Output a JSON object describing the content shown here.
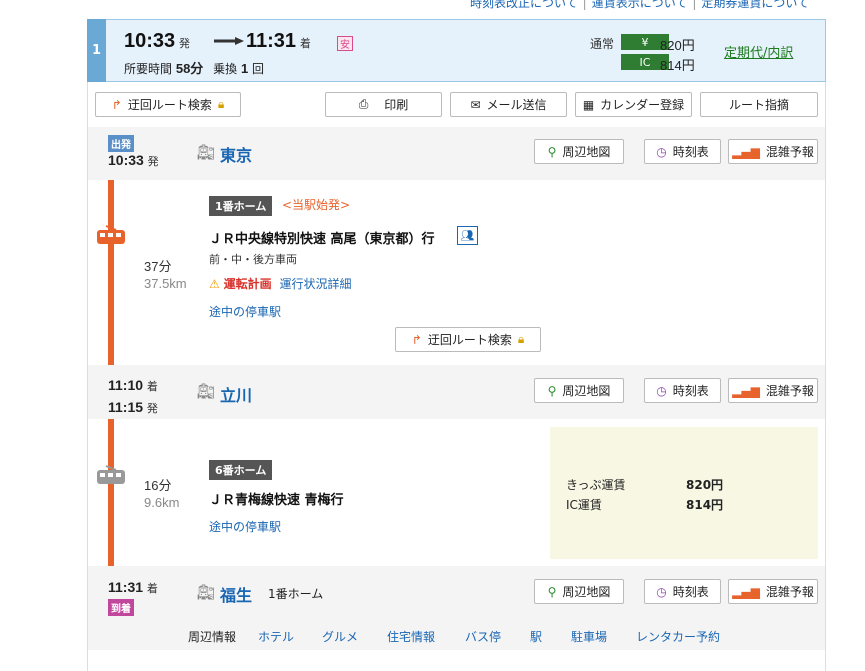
{
  "top_links": [
    "時刻表改正について",
    "運賃表示について",
    "定期券運賃について"
  ],
  "summary": {
    "route_number": "1",
    "depart_time": "10:33",
    "depart_suffix": "発",
    "arrive_time": "11:31",
    "arrive_suffix": "着",
    "safe_badge": "安",
    "duration_label": "所要時間",
    "duration_value": "58分",
    "transfer_label": "乗換",
    "transfer_value": "1",
    "transfer_unit": "回",
    "fare_normal_label": "通常",
    "fare_normal_badge": "¥",
    "fare_normal_amount": "820円",
    "fare_ic_badge": "IC",
    "fare_ic_amount": "814円",
    "teiki_link": "定期代/内訳"
  },
  "toolbar": {
    "detour_search": "迂回ルート検索",
    "print": "印刷",
    "mail": "メール送信",
    "calendar": "カレンダー登録",
    "route_guide": "ルート指摘"
  },
  "station_buttons": {
    "map": "周辺地図",
    "timetable": "時刻表",
    "congestion": "混雑予報"
  },
  "stations": {
    "tokyo": {
      "badge": "出発",
      "time": "10:33",
      "suffix": "発",
      "name": "東京"
    },
    "tachikawa": {
      "arrive_time": "11:10",
      "arrive_suffix": "着",
      "depart_time": "11:15",
      "depart_suffix": "発",
      "name": "立川"
    },
    "fussa": {
      "time": "11:31",
      "suffix": "着",
      "badge": "到着",
      "name": "福生",
      "platform": "1番ホーム"
    }
  },
  "segments": {
    "seg1": {
      "platform": "1番ホーム",
      "origin_note": "<当駅始発>",
      "train": "ＪＲ中央線特別快速 高尾（東京都）行",
      "cars": "前・中・後方車両",
      "warning": "運転計画",
      "status_link": "運行状況詳細",
      "stops_link": "途中の停車駅",
      "duration": "37分",
      "distance": "37.5km",
      "detour": "迂回ルート検索"
    },
    "seg2": {
      "platform": "6番ホーム",
      "train": "ＪＲ青梅線快速 青梅行",
      "stops_link": "途中の停車駅",
      "duration": "16分",
      "distance": "9.6km"
    }
  },
  "fare_box": {
    "ticket_label": "きっぷ運賃",
    "ticket_amount": "820円",
    "ic_label": "IC運賃",
    "ic_amount": "814円"
  },
  "nearby": {
    "label": "周辺情報",
    "links": [
      "ホテル",
      "グルメ",
      "住宅情報",
      "バス停",
      "駅",
      "駐車場",
      "レンタカー予約"
    ]
  },
  "colors": {
    "line_chuo": "#e8622c",
    "link": "#1a66b3",
    "fare_green": "#2e7d32",
    "arrive_badge": "#c1479c",
    "depart_badge": "#5b8fc7"
  }
}
